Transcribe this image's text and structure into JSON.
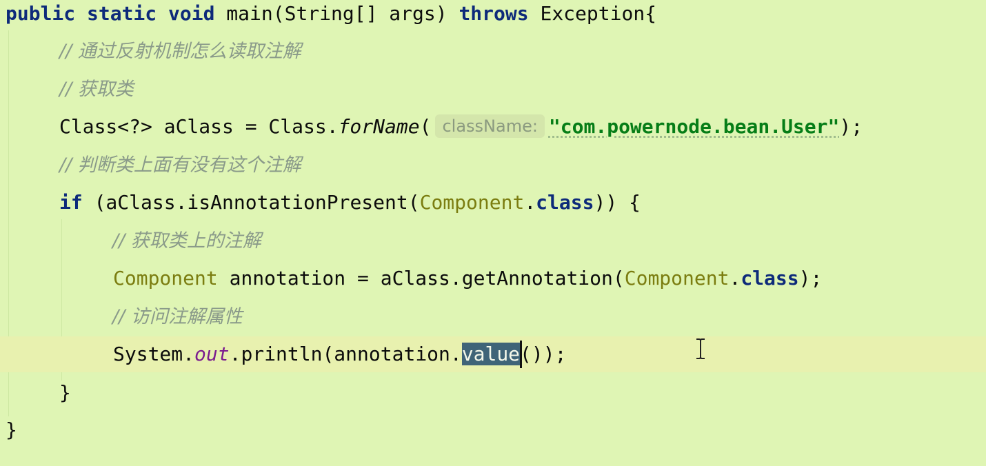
{
  "code": {
    "main_signature": {
      "kw1": "public static void",
      "name": " main(String[] args) ",
      "kw2": "throws",
      "rest": " Exception{"
    },
    "comment_reflect": "// 通过反射机制怎么读取注解",
    "comment_get_class": "// 获取类",
    "class_decl": {
      "start": "Class<?> aClass = Class.",
      "method": "forName",
      "open": "(",
      "hint": "className:",
      "string": "\"com.powernode.bean.User\"",
      "end": ");"
    },
    "comment_check": "// 判断类上面有没有这个注解",
    "if_line": {
      "kw": "if",
      "mid": " (aClass.isAnnotationPresent(",
      "cls": "Component",
      "dot": ".",
      "kw2": "class",
      "end": ")) {"
    },
    "comment_get_annotation": "// 获取类上的注解",
    "annotation_decl": {
      "cls1": "Component",
      "mid": " annotation = aClass.getAnnotation(",
      "cls2": "Component",
      "dot": ".",
      "kw": "class",
      "end": ");"
    },
    "comment_access": "// 访问注解属性",
    "println_line": {
      "start": "System.",
      "field": "out",
      "mid": ".println(annotation.",
      "selected": "value",
      "end": "());"
    },
    "close_if": "}",
    "close_main": "}"
  },
  "colors": {
    "background": "#dff5b4",
    "current_line": "#e8f1af",
    "keyword": "#0d2a7a",
    "class_name": "#7b7d10",
    "string": "#067d17",
    "comment": "#8a9a8a",
    "selection": "#3f6478"
  },
  "icons": {
    "mouse_cursor": "text-ibeam-cursor-icon"
  }
}
